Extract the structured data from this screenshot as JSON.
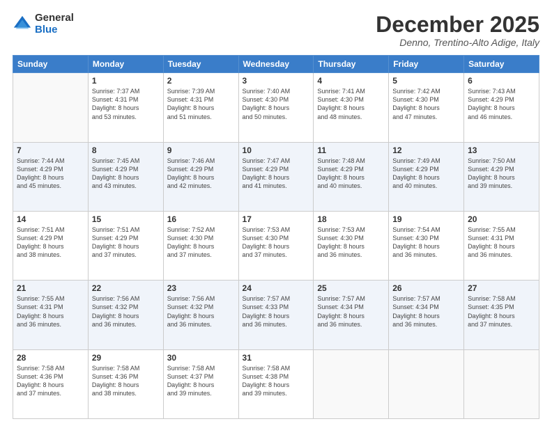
{
  "header": {
    "logo_general": "General",
    "logo_blue": "Blue",
    "month_title": "December 2025",
    "location": "Denno, Trentino-Alto Adige, Italy"
  },
  "days_of_week": [
    "Sunday",
    "Monday",
    "Tuesday",
    "Wednesday",
    "Thursday",
    "Friday",
    "Saturday"
  ],
  "weeks": [
    [
      {
        "day": "",
        "info": ""
      },
      {
        "day": "1",
        "info": "Sunrise: 7:37 AM\nSunset: 4:31 PM\nDaylight: 8 hours\nand 53 minutes."
      },
      {
        "day": "2",
        "info": "Sunrise: 7:39 AM\nSunset: 4:31 PM\nDaylight: 8 hours\nand 51 minutes."
      },
      {
        "day": "3",
        "info": "Sunrise: 7:40 AM\nSunset: 4:30 PM\nDaylight: 8 hours\nand 50 minutes."
      },
      {
        "day": "4",
        "info": "Sunrise: 7:41 AM\nSunset: 4:30 PM\nDaylight: 8 hours\nand 48 minutes."
      },
      {
        "day": "5",
        "info": "Sunrise: 7:42 AM\nSunset: 4:30 PM\nDaylight: 8 hours\nand 47 minutes."
      },
      {
        "day": "6",
        "info": "Sunrise: 7:43 AM\nSunset: 4:29 PM\nDaylight: 8 hours\nand 46 minutes."
      }
    ],
    [
      {
        "day": "7",
        "info": "Sunrise: 7:44 AM\nSunset: 4:29 PM\nDaylight: 8 hours\nand 45 minutes."
      },
      {
        "day": "8",
        "info": "Sunrise: 7:45 AM\nSunset: 4:29 PM\nDaylight: 8 hours\nand 43 minutes."
      },
      {
        "day": "9",
        "info": "Sunrise: 7:46 AM\nSunset: 4:29 PM\nDaylight: 8 hours\nand 42 minutes."
      },
      {
        "day": "10",
        "info": "Sunrise: 7:47 AM\nSunset: 4:29 PM\nDaylight: 8 hours\nand 41 minutes."
      },
      {
        "day": "11",
        "info": "Sunrise: 7:48 AM\nSunset: 4:29 PM\nDaylight: 8 hours\nand 40 minutes."
      },
      {
        "day": "12",
        "info": "Sunrise: 7:49 AM\nSunset: 4:29 PM\nDaylight: 8 hours\nand 40 minutes."
      },
      {
        "day": "13",
        "info": "Sunrise: 7:50 AM\nSunset: 4:29 PM\nDaylight: 8 hours\nand 39 minutes."
      }
    ],
    [
      {
        "day": "14",
        "info": "Sunrise: 7:51 AM\nSunset: 4:29 PM\nDaylight: 8 hours\nand 38 minutes."
      },
      {
        "day": "15",
        "info": "Sunrise: 7:51 AM\nSunset: 4:29 PM\nDaylight: 8 hours\nand 37 minutes."
      },
      {
        "day": "16",
        "info": "Sunrise: 7:52 AM\nSunset: 4:30 PM\nDaylight: 8 hours\nand 37 minutes."
      },
      {
        "day": "17",
        "info": "Sunrise: 7:53 AM\nSunset: 4:30 PM\nDaylight: 8 hours\nand 37 minutes."
      },
      {
        "day": "18",
        "info": "Sunrise: 7:53 AM\nSunset: 4:30 PM\nDaylight: 8 hours\nand 36 minutes."
      },
      {
        "day": "19",
        "info": "Sunrise: 7:54 AM\nSunset: 4:30 PM\nDaylight: 8 hours\nand 36 minutes."
      },
      {
        "day": "20",
        "info": "Sunrise: 7:55 AM\nSunset: 4:31 PM\nDaylight: 8 hours\nand 36 minutes."
      }
    ],
    [
      {
        "day": "21",
        "info": "Sunrise: 7:55 AM\nSunset: 4:31 PM\nDaylight: 8 hours\nand 36 minutes."
      },
      {
        "day": "22",
        "info": "Sunrise: 7:56 AM\nSunset: 4:32 PM\nDaylight: 8 hours\nand 36 minutes."
      },
      {
        "day": "23",
        "info": "Sunrise: 7:56 AM\nSunset: 4:32 PM\nDaylight: 8 hours\nand 36 minutes."
      },
      {
        "day": "24",
        "info": "Sunrise: 7:57 AM\nSunset: 4:33 PM\nDaylight: 8 hours\nand 36 minutes."
      },
      {
        "day": "25",
        "info": "Sunrise: 7:57 AM\nSunset: 4:34 PM\nDaylight: 8 hours\nand 36 minutes."
      },
      {
        "day": "26",
        "info": "Sunrise: 7:57 AM\nSunset: 4:34 PM\nDaylight: 8 hours\nand 36 minutes."
      },
      {
        "day": "27",
        "info": "Sunrise: 7:58 AM\nSunset: 4:35 PM\nDaylight: 8 hours\nand 37 minutes."
      }
    ],
    [
      {
        "day": "28",
        "info": "Sunrise: 7:58 AM\nSunset: 4:36 PM\nDaylight: 8 hours\nand 37 minutes."
      },
      {
        "day": "29",
        "info": "Sunrise: 7:58 AM\nSunset: 4:36 PM\nDaylight: 8 hours\nand 38 minutes."
      },
      {
        "day": "30",
        "info": "Sunrise: 7:58 AM\nSunset: 4:37 PM\nDaylight: 8 hours\nand 39 minutes."
      },
      {
        "day": "31",
        "info": "Sunrise: 7:58 AM\nSunset: 4:38 PM\nDaylight: 8 hours\nand 39 minutes."
      },
      {
        "day": "",
        "info": ""
      },
      {
        "day": "",
        "info": ""
      },
      {
        "day": "",
        "info": ""
      }
    ]
  ]
}
